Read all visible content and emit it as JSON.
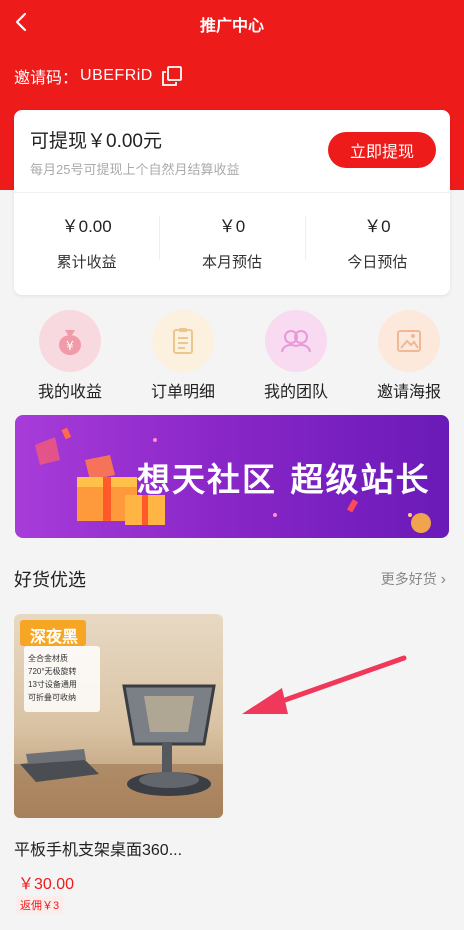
{
  "header": {
    "title": "推广中心"
  },
  "invite": {
    "label": "邀请码：",
    "code": "UBEFRiD"
  },
  "withdraw": {
    "amount_text": "可提现￥0.00元",
    "tip": "每月25号可提现上个自然月结算收益",
    "button": "立即提现"
  },
  "stats": [
    {
      "value": "￥0.00",
      "label": "累计收益"
    },
    {
      "value": "￥0",
      "label": "本月预估"
    },
    {
      "value": "￥0",
      "label": "今日预估"
    }
  ],
  "menu": [
    {
      "label": "我的收益",
      "icon": "money-bag-icon",
      "color": "#f4c6cf"
    },
    {
      "label": "订单明细",
      "icon": "clipboard-icon",
      "color": "#fbeeda"
    },
    {
      "label": "我的团队",
      "icon": "team-icon",
      "color": "#f6d5ee"
    },
    {
      "label": "邀请海报",
      "icon": "poster-icon",
      "color": "#fbe7d8"
    }
  ],
  "banner": {
    "text": "想天社区 超级站长"
  },
  "goods": {
    "title": "好货优选",
    "more": "更多好货"
  },
  "product": {
    "badge": "深夜黑",
    "features": [
      "全合金材质",
      "720°无极旋转",
      "13寸设备通用",
      "可折叠可收纳"
    ],
    "name": "平板手机支架桌面360...",
    "price": "￥30.00",
    "rebate": "返佣￥3"
  },
  "colors": {
    "brand_red": "#ee1b1b",
    "banner_purple": "#8b27c9"
  }
}
